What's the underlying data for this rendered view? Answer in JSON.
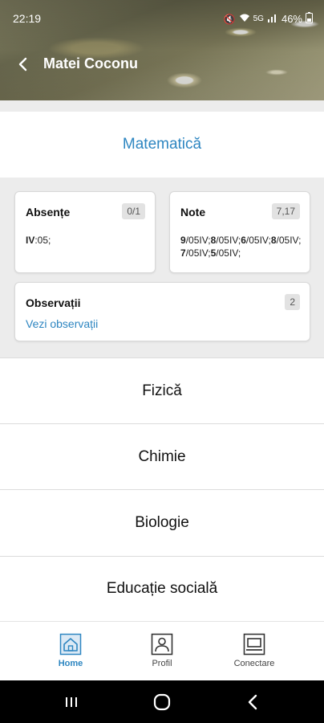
{
  "status_bar": {
    "time": "22:19",
    "battery": "46%",
    "signal_label": "5G"
  },
  "app_bar": {
    "title": "Matei Coconu"
  },
  "subjects": [
    {
      "name": "Matematică",
      "active": true
    },
    {
      "name": "Fizică",
      "active": false
    },
    {
      "name": "Chimie",
      "active": false
    },
    {
      "name": "Biologie",
      "active": false
    },
    {
      "name": "Educație socială",
      "active": false
    }
  ],
  "absente": {
    "title": "Absențe",
    "badge": "0/1",
    "prefix": "IV",
    "text": ":05;"
  },
  "note": {
    "title": "Note",
    "badge": "7,17",
    "grades": [
      {
        "grade": "9",
        "date": "/05IV;"
      },
      {
        "grade": "8",
        "date": "/05IV;"
      },
      {
        "grade": "6",
        "date": "/05IV;"
      },
      {
        "grade": "8",
        "date": "/05IV;"
      },
      {
        "grade": "7",
        "date": "/05IV;"
      },
      {
        "grade": "5",
        "date": "/05IV;"
      }
    ]
  },
  "observatii": {
    "title": "Observații",
    "badge": "2",
    "link": "Vezi observații"
  },
  "bottom_nav": {
    "items": [
      {
        "label": "Home",
        "icon": "home-icon",
        "active": true
      },
      {
        "label": "Profil",
        "icon": "profile-icon",
        "active": false
      },
      {
        "label": "Conectare",
        "icon": "laptop-icon",
        "active": false
      }
    ]
  },
  "colors": {
    "accent": "#2e86c1",
    "background": "#ececec"
  }
}
